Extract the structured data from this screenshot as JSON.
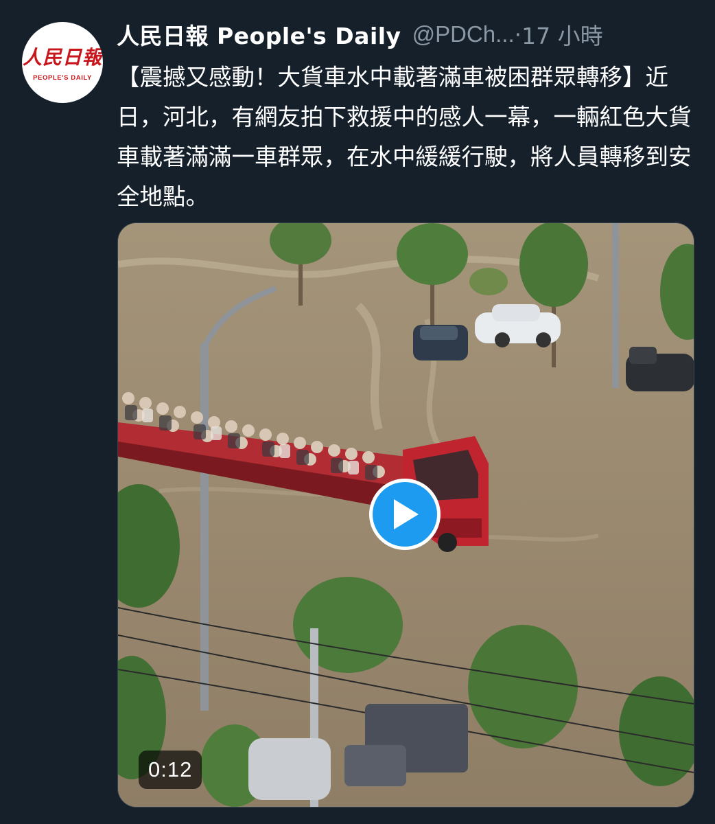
{
  "tweet": {
    "avatar": {
      "logo_text": "人民日報",
      "sub_text": "PEOPLE'S DAILY"
    },
    "display_name": "人民日報  People's Daily",
    "handle": "@PDCh...",
    "time_separator": "·",
    "time_ago": "17 小時",
    "text": "【震撼又感動！大貨車水中載著滿車被困群眾轉移】近日，河北，有網友拍下救援中的感人一幕，一輛紅色大貨車載著滿滿一車群眾，在水中緩緩行駛，將人員轉移到安全地點。"
  },
  "media": {
    "type": "video",
    "duration": "0:12",
    "play_icon": "play-icon",
    "colors": {
      "flood_water": "#9c8b72",
      "truck_red": "#c0242f",
      "play_blue": "#1d9bf0"
    }
  },
  "theme": {
    "background": "#15202b",
    "text_primary": "#ffffff",
    "text_secondary": "#8b98a5"
  }
}
